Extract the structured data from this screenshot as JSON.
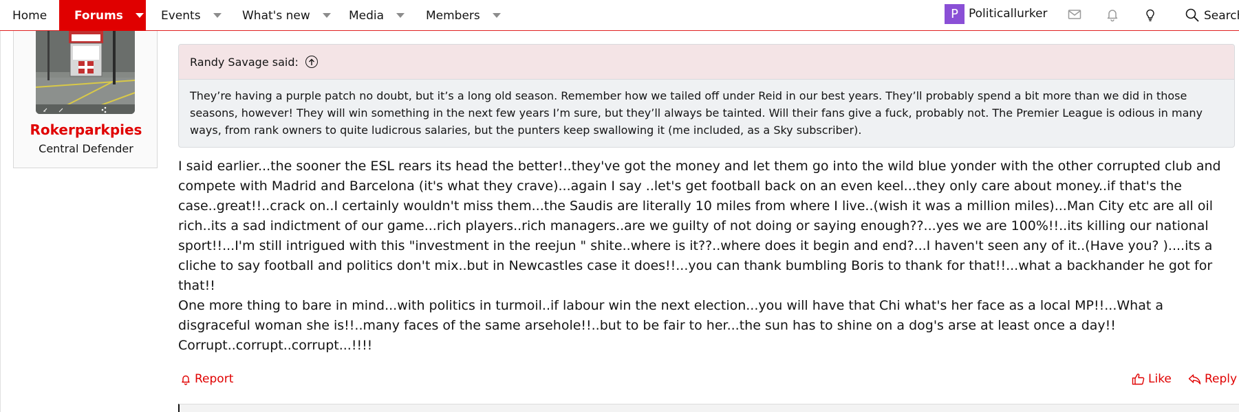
{
  "nav": {
    "items": [
      {
        "label": "Home",
        "has_menu": false,
        "active": false
      },
      {
        "label": "Forums",
        "has_menu": true,
        "active": true
      },
      {
        "label": "Events",
        "has_menu": true,
        "active": false
      },
      {
        "label": "What's new",
        "has_menu": true,
        "active": false
      },
      {
        "label": "Media",
        "has_menu": true,
        "active": false
      },
      {
        "label": "Members",
        "has_menu": true,
        "active": false
      }
    ],
    "user": {
      "initial": "P",
      "name": "Politicallurker",
      "avatar_color": "#8a4fd6"
    },
    "icons": [
      "envelope-icon",
      "bell-icon",
      "lightbulb-icon",
      "search-icon"
    ],
    "search_label": "Search"
  },
  "poster": {
    "name": "Rokerparkpies",
    "title": "Central Defender"
  },
  "quote": {
    "author_line": "Randy Savage said:",
    "text": "They’re having a purple patch no doubt, but it’s a long old season. Remember how we tailed off under Reid in our best years. They’ll probably spend a bit more than we did in those seasons, however! They will win something in the next few years I’m sure, but they’ll always be tainted. Will their fans give a fuck, probably not. The Premier League is odious in many ways, from rank owners to quite ludicrous salaries, but the punters keep swallowing it (me included, as a Sky subscriber)."
  },
  "message": {
    "paragraphs": [
      "I said earlier...the sooner the ESL rears its head the better!..they've got the money and let them go into the wild blue yonder with the other corrupted club and compete with Madrid and Barcelona (it's what they crave)...again I say ..let's get football back on an even keel...they only care about money..if that's the case..great!!..crack on..I certainly wouldn't miss them...the Saudis are literally 10 miles from where I live..(wish it was a million miles)...Man City etc are all oil rich..its a sad indictment of our game...rich players..rich managers..are we guilty of not doing or saying enough??...yes we are 100%!!..its killing our national sport!!...I'm still intrigued with this \"investment in the reejun \" shite..where is it??..where does it begin and end?...I haven't seen any of it..(Have you? )....its a cliche to say football and politics don't mix..but in Newcastles case it does!!...you can thank bumbling Boris to thank for that!!...what a backhander he got for that!!",
      "One more thing to bare in mind...with politics in turmoil..if labour win the next election...you will have that Chi what's her face as a local MP!!...What a disgraceful woman she is!!..many faces of the same arsehole!!..but to be fair to her...the sun has to shine on a dog's arse at least once a day!!",
      "Corrupt..corrupt..corrupt...!!!!"
    ]
  },
  "actions": {
    "report": "Report",
    "like": "Like",
    "reply": "Reply"
  },
  "colors": {
    "accent": "#e00000",
    "quote_header_bg": "#f4e4e6",
    "quote_body_bg": "#eff1f3"
  }
}
